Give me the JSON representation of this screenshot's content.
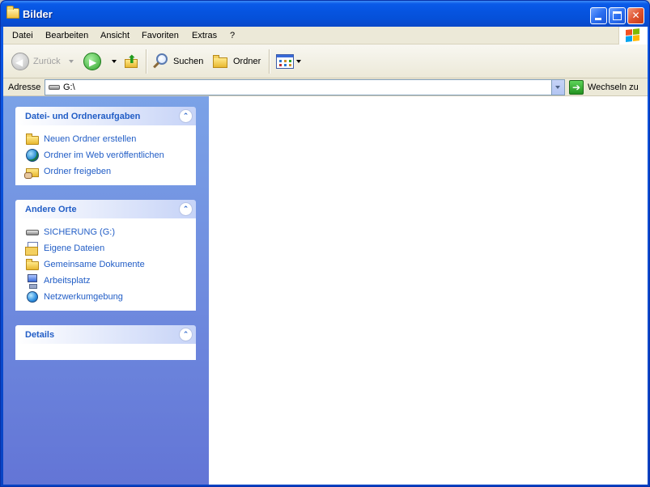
{
  "window": {
    "title": "Bilder",
    "minimize_icon": "minimize-icon",
    "maximize_icon": "maximize-icon",
    "close_icon": "close-icon",
    "close_glyph": "✕"
  },
  "menubar": {
    "items": [
      "Datei",
      "Bearbeiten",
      "Ansicht",
      "Favoriten",
      "Extras",
      "?"
    ]
  },
  "toolbar": {
    "back_label": "Zurück",
    "search_label": "Suchen",
    "folders_label": "Ordner",
    "back_glyph": "◀",
    "forward_glyph": "▶",
    "up_glyph": "⬆"
  },
  "address": {
    "label": "Adresse",
    "value": "G:\\",
    "go_label": "Wechseln zu",
    "go_glyph": "➔"
  },
  "taskpane": {
    "groups": [
      {
        "title": "Datei- und Ordneraufgaben",
        "tasks": [
          "Neuen Ordner erstellen",
          "Ordner im Web veröffentlichen",
          "Ordner freigeben"
        ]
      },
      {
        "title": "Andere Orte",
        "tasks": [
          "SICHERUNG (G:)",
          "Eigene Dateien",
          "Gemeinsame Dokumente",
          "Arbeitsplatz",
          "Netzwerkumgebung"
        ]
      },
      {
        "title": "Details",
        "tasks": []
      }
    ],
    "collapse_glyph": "⌃"
  },
  "colors": {
    "title_blue": "#0a5ae8",
    "task_link": "#215dc6",
    "taskpane_bg": "#7ba2e7",
    "chrome": "#ece9d8"
  }
}
